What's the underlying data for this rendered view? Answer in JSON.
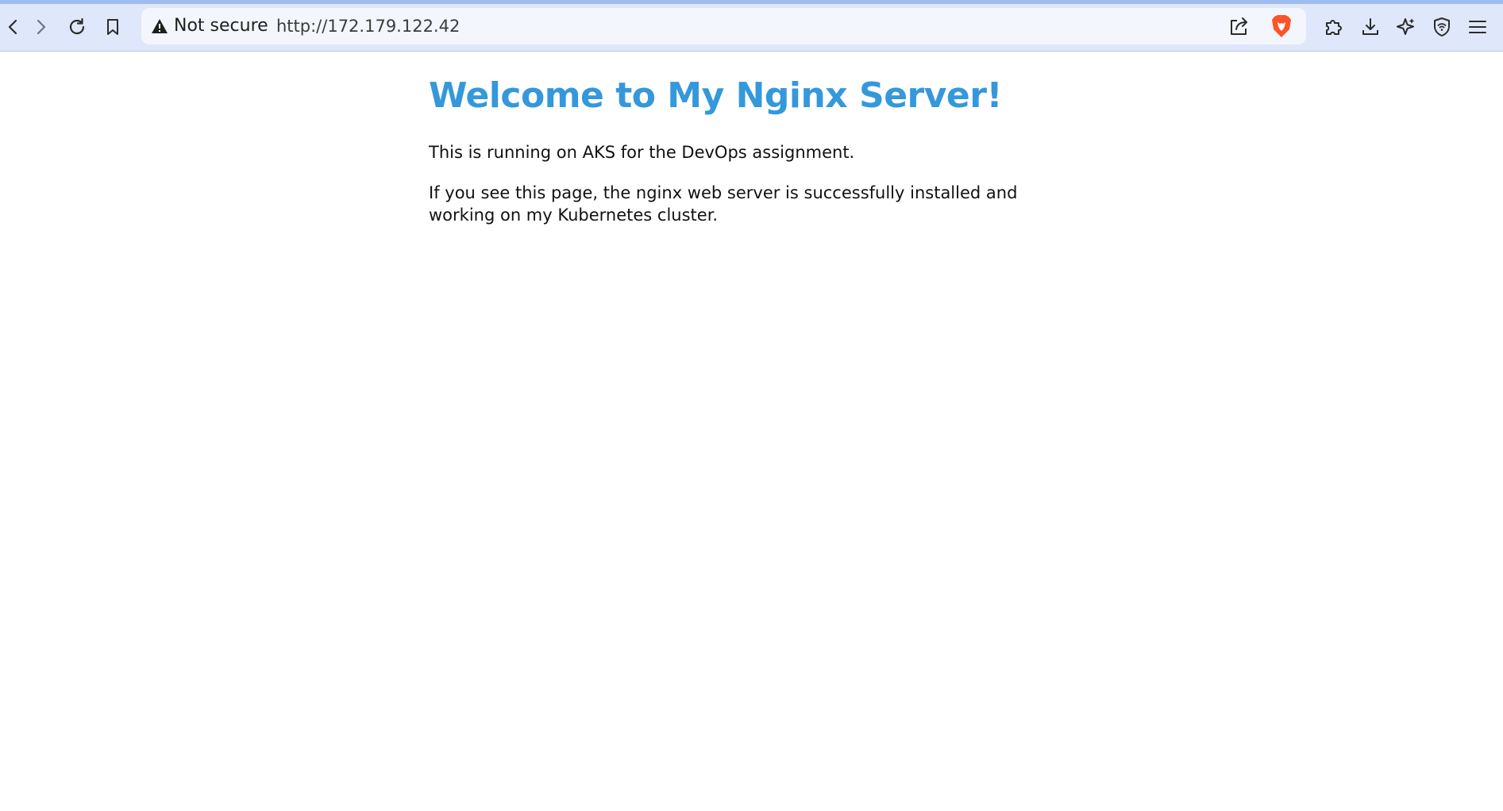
{
  "browser": {
    "security_label": "Not secure",
    "url": "http://172.179.122.42",
    "icons": {
      "back": "back-arrow-icon",
      "forward": "forward-arrow-icon",
      "reload": "reload-icon",
      "bookmark": "bookmark-icon",
      "warning": "warning-triangle-icon",
      "share": "share-icon",
      "brave_shields": "brave-lion-icon",
      "extensions": "puzzle-icon",
      "downloads": "download-icon",
      "leo": "sparkle-star-icon",
      "vpn": "shield-wifi-icon",
      "menu": "hamburger-menu-icon"
    },
    "colors": {
      "toolbar": "#dfe8fa",
      "brave_orange": "#fb542b"
    }
  },
  "page": {
    "heading": "Welcome to My Nginx Server!",
    "paragraph1": "This is running on AKS for the DevOps assignment.",
    "paragraph2": "If you see this page, the nginx web server is successfully installed and working on my Kubernetes cluster.",
    "colors": {
      "heading": "#3498db",
      "text": "#111111"
    }
  }
}
